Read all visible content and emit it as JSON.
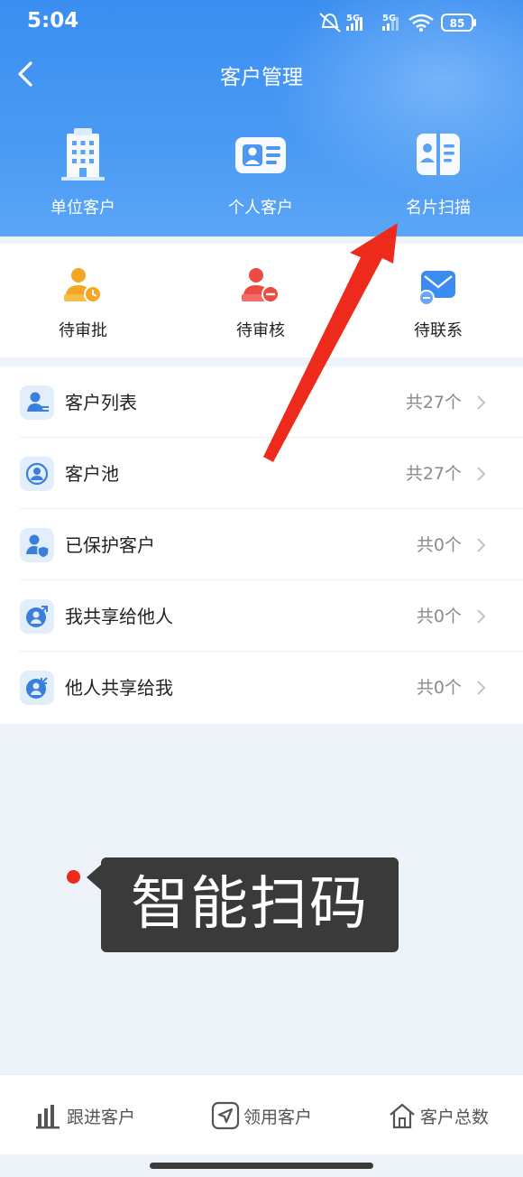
{
  "status_bar": {
    "time": "5:04",
    "battery": "85",
    "network_1": "5G",
    "network_2": "5G"
  },
  "nav": {
    "title": "客户管理"
  },
  "quick_actions": [
    {
      "label": "单位客户",
      "icon": "building-icon"
    },
    {
      "label": "个人客户",
      "icon": "id-card-icon"
    },
    {
      "label": "名片扫描",
      "icon": "business-card-icon"
    }
  ],
  "status_items": [
    {
      "label": "待审批",
      "icon": "pending-approval-icon",
      "color": "#f5a623"
    },
    {
      "label": "待审核",
      "icon": "pending-review-icon",
      "color": "#ee4b43"
    },
    {
      "label": "待联系",
      "icon": "pending-contact-icon",
      "color": "#3b8cf0"
    }
  ],
  "customer_list": [
    {
      "label": "客户列表",
      "count": "共27个",
      "icon": "customer-list-icon"
    },
    {
      "label": "客户池",
      "count": "共27个",
      "icon": "customer-pool-icon"
    },
    {
      "label": "已保护客户",
      "count": "共0个",
      "icon": "protected-customer-icon"
    },
    {
      "label": "我共享给他人",
      "count": "共0个",
      "icon": "share-out-icon"
    },
    {
      "label": "他人共享给我",
      "count": "共0个",
      "icon": "share-in-icon"
    }
  ],
  "caption": {
    "text": "智能扫码"
  },
  "tabbar": [
    {
      "label": "跟进客户",
      "icon": "bar-chart-icon"
    },
    {
      "label": "领用客户",
      "icon": "navigation-icon"
    },
    {
      "label": "客户总数",
      "icon": "home-icon"
    }
  ],
  "colors": {
    "header_blue": "#4a9af4",
    "annotation_red": "#ee2a1d",
    "background": "#eef3f9"
  }
}
